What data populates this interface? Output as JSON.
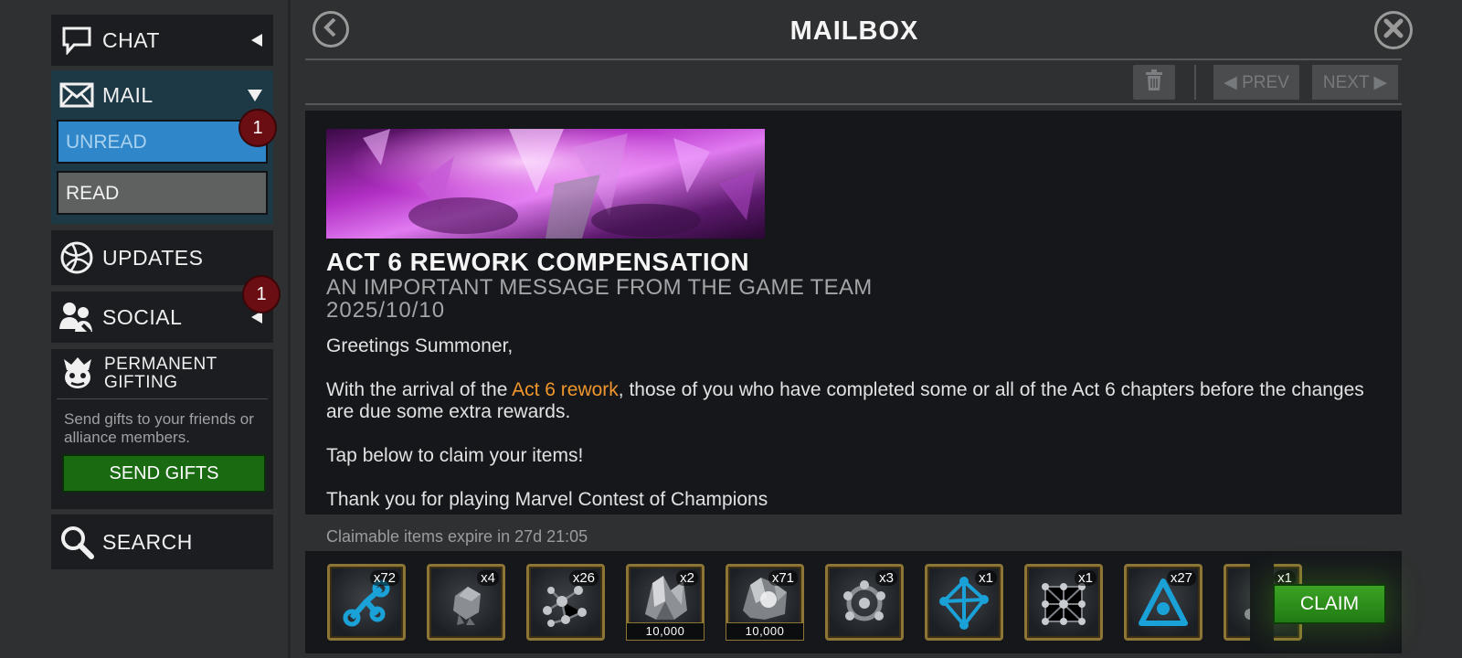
{
  "sidebar": {
    "chat": {
      "label": "CHAT",
      "icon": "chat-bubble-icon"
    },
    "mail": {
      "label": "MAIL",
      "icon": "envelope-icon",
      "unread_label": "UNREAD",
      "unread_badge": "1",
      "read_label": "READ"
    },
    "updates": {
      "label": "UPDATES",
      "icon": "globe-icon"
    },
    "social": {
      "label": "SOCIAL",
      "icon": "people-icon",
      "badge": "1"
    },
    "gifting": {
      "title": "PERMANENT GIFTING",
      "icon": "gift-character-icon",
      "description": "Send gifts to your friends or alliance members.",
      "button_label": "SEND GIFTS"
    },
    "search": {
      "label": "SEARCH",
      "icon": "magnifier-icon"
    }
  },
  "header": {
    "title": "MAILBOX"
  },
  "toolbar": {
    "prev_label": "◀ PREV",
    "next_label": "NEXT ▶"
  },
  "message": {
    "title": "ACT 6 REWORK COMPENSATION",
    "subtitle": "AN IMPORTANT MESSAGE FROM THE GAME TEAM",
    "date": "2025/10/10",
    "greeting": "Greetings Summoner,",
    "p1_before": "With the arrival of the ",
    "p1_highlight": "Act 6 rework",
    "p1_after": ", those of you who have completed some or all of the Act 6 chapters before the changes are due some extra rewards.",
    "p2": "Tap below to claim your items!",
    "p3": "Thank you for playing Marvel Contest of Champions"
  },
  "rewards": {
    "expire_text": "Claimable items expire in 27d 21:05",
    "items": [
      {
        "qty": "x72",
        "icon": "blue-catalyst-icon"
      },
      {
        "qty": "x4",
        "icon": "grey-rock-icon"
      },
      {
        "qty": "x26",
        "icon": "molecule-catalyst-icon"
      },
      {
        "qty": "x2",
        "icon": "crystal-shard-icon",
        "amount": "10,000"
      },
      {
        "qty": "x71",
        "icon": "crystal-shard-icon",
        "amount": "10,000"
      },
      {
        "qty": "x3",
        "icon": "ring-catalyst-icon"
      },
      {
        "qty": "x1",
        "icon": "blue-lattice-catalyst-icon"
      },
      {
        "qty": "x1",
        "icon": "dense-lattice-catalyst-icon"
      },
      {
        "qty": "x27",
        "icon": "blue-triangle-catalyst-icon"
      },
      {
        "qty": "x1",
        "icon": "partial-item-icon"
      }
    ],
    "claim_label": "CLAIM"
  },
  "colors": {
    "accent_unread": "#2f86c9",
    "badge": "#6b0e13",
    "highlight": "#f0962c",
    "claim": "#3ba323",
    "send_gifts": "#1a6a12"
  }
}
